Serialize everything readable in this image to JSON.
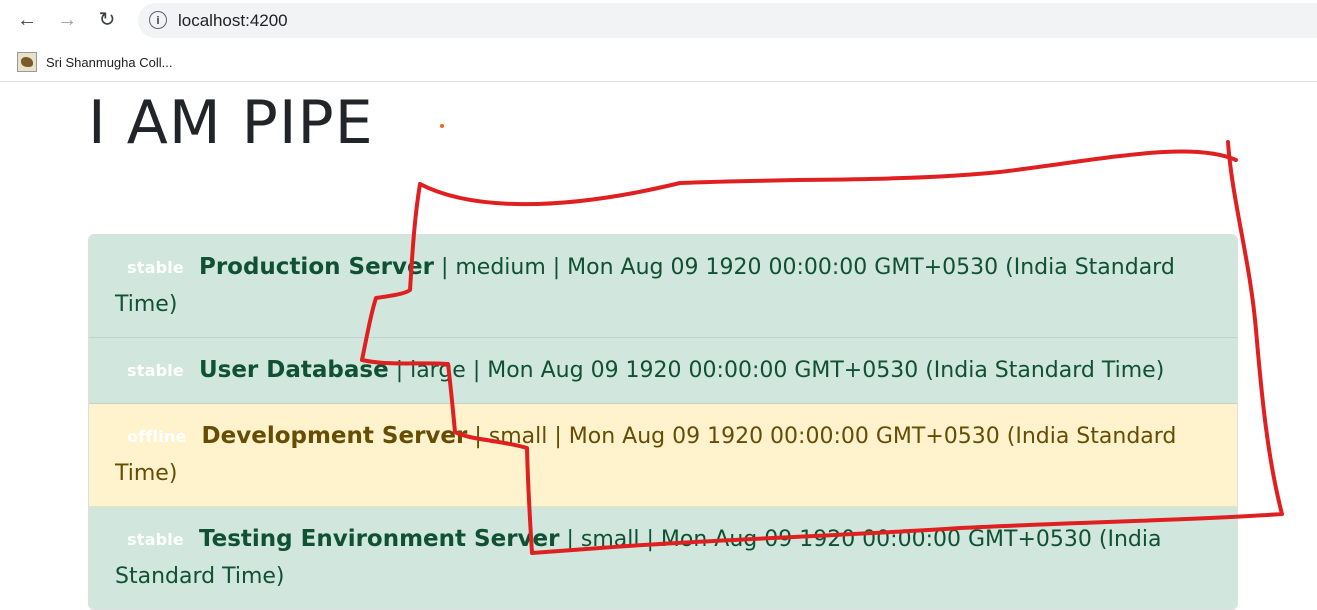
{
  "browser": {
    "url": "localhost:4200",
    "bookmark_label": "Sri Shanmugha Coll..."
  },
  "page": {
    "title": "I AM PIPE"
  },
  "servers": [
    {
      "status": "stable",
      "name": "Production Server",
      "details": "| medium | Mon Aug 09 1920 00:00:00 GMT+0530 (India Standard Time)",
      "variant": "success"
    },
    {
      "status": "stable",
      "name": "User Database",
      "details": "| large | Mon Aug 09 1920 00:00:00 GMT+0530 (India Standard Time)",
      "variant": "success"
    },
    {
      "status": "offline",
      "name": "Development Server",
      "details": "| small | Mon Aug 09 1920 00:00:00 GMT+0530 (India Standard Time)",
      "variant": "warning"
    },
    {
      "status": "stable",
      "name": "Testing Environment Server",
      "details": "| small | Mon Aug 09 1920 00:00:00 GMT+0530 (India Standard Time)",
      "variant": "success"
    }
  ],
  "colors": {
    "success_bg": "#d1e7dd",
    "warning_bg": "#fff3cd",
    "annotation": "#e02020"
  }
}
